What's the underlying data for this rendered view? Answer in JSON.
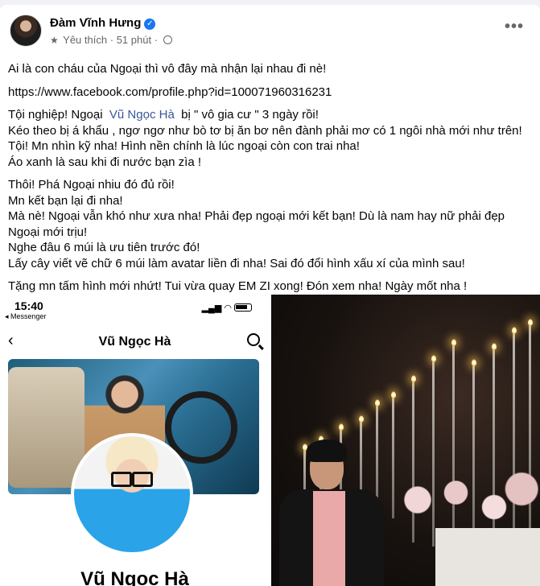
{
  "post": {
    "author": "Đàm Vĩnh Hưng",
    "meta_favorite": "Yêu thích",
    "meta_separator": "·",
    "meta_time": "51 phút",
    "meta_separator_2": "·",
    "paragraphs": [
      [
        "Ai là con cháu của Ngoại thì vô đây mà nhận lại nhau đi nè!"
      ],
      [
        "https://www.facebook.com/profile.php?id=100071960316231"
      ],
      [
        "Tội nghiệp! Ngoại",
        "Vũ Ngọc Hà",
        "bị \" vô gia cư \" 3 ngày rồi!",
        "Kéo theo bị á khẩu , ngơ ngơ như bò tơ bị ăn bơ nên đành phải mơ có 1 ngôi nhà mới như trên!",
        "Tội! Mn nhìn kỹ nha! Hình nền chính là lúc ngoại còn con trai nha!",
        "Áo xanh là sau khi đi nước bạn zìa !"
      ],
      [
        "Thôi! Phá Ngoại nhiu đó đủ rồi!",
        "Mn kết bạn lại đi nha!",
        "Mà nè! Ngoại vẫn khó như xưa nha! Phải đẹp ngoại mới kết bạn! Dù là nam hay nữ phải đẹp",
        "Ngoại mới trịu!",
        "Nghe đâu 6 múi là ưu tiên trước đó!",
        "Lấy cây viết vẽ chữ 6 múi làm avatar liền đi nha! Sai đó đổi hình xấu xí của mình sau!"
      ],
      [
        "Tặng mn tấm hình mới nhứt! Tui vừa quay EM ZI xong! Đón xem nha! Ngày mốt nha !"
      ]
    ]
  },
  "screenshot": {
    "time": "15:40",
    "back_label": "◂ Messenger",
    "title": "Vũ Ngọc Hà",
    "profile_name": "Vũ Ngọc Hà"
  },
  "colors": {
    "link": "#385898",
    "verified": "#1877f2",
    "meta": "#65676b"
  }
}
